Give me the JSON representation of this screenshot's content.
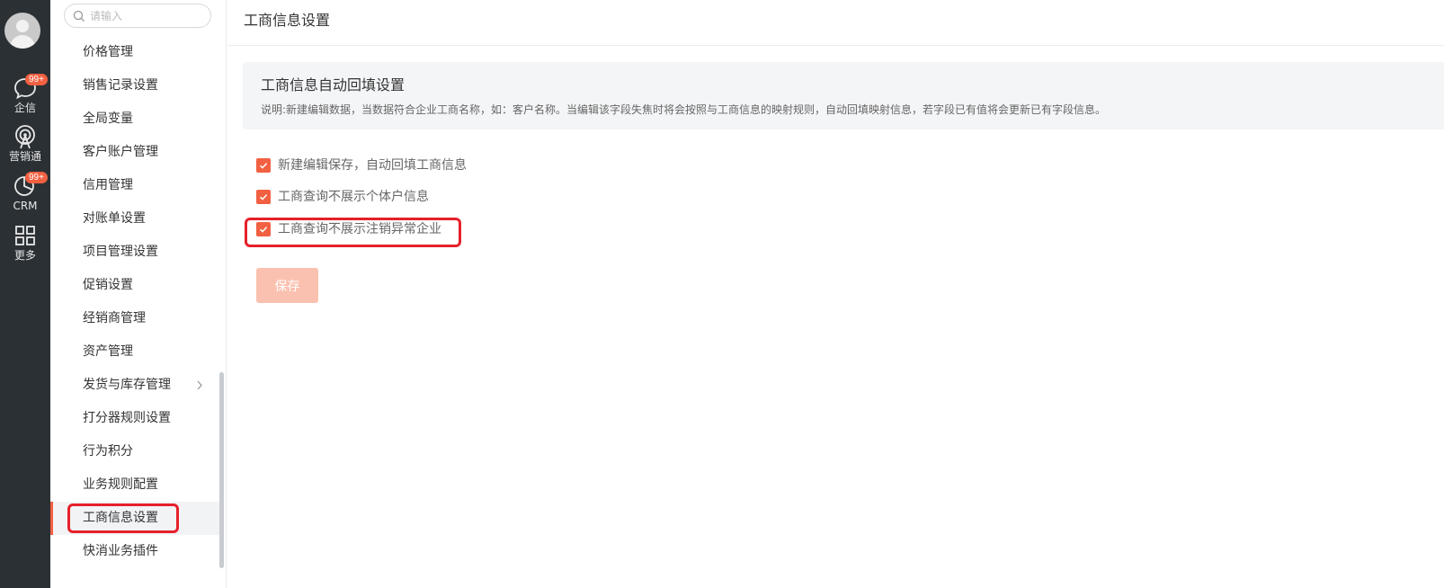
{
  "rail": {
    "items": [
      {
        "label": "企信",
        "icon": "chat-bubble-icon",
        "badge": "99+"
      },
      {
        "label": "营销通",
        "icon": "broadcast-icon",
        "badge": ""
      },
      {
        "label": "CRM",
        "icon": "pie-chart-icon",
        "badge": "99+"
      },
      {
        "label": "更多",
        "icon": "grid-icon",
        "badge": ""
      }
    ]
  },
  "sidebar": {
    "search_placeholder": "请输入",
    "items": [
      {
        "label": "价格管理"
      },
      {
        "label": "销售记录设置"
      },
      {
        "label": "全局变量"
      },
      {
        "label": "客户账户管理"
      },
      {
        "label": "信用管理"
      },
      {
        "label": "对账单设置"
      },
      {
        "label": "项目管理设置"
      },
      {
        "label": "促销设置"
      },
      {
        "label": "经销商管理"
      },
      {
        "label": "资产管理"
      },
      {
        "label": "发货与库存管理"
      },
      {
        "label": "打分器规则设置"
      },
      {
        "label": "行为积分"
      },
      {
        "label": "业务规则配置"
      },
      {
        "label": "工商信息设置"
      },
      {
        "label": "快消业务插件"
      }
    ],
    "active_item": "工商信息设置"
  },
  "main": {
    "page_title": "工商信息设置",
    "info": {
      "title": "工商信息自动回填设置",
      "description": "说明:新建编辑数据，当数据符合企业工商名称，如：客户名称。当编辑该字段失焦时将会按照与工商信息的映射规则，自动回填映射信息，若字段已有值将会更新已有字段信息。"
    },
    "options": [
      {
        "label": "新建编辑保存，自动回填工商信息",
        "checked": true
      },
      {
        "label": "工商查询不展示个体户信息",
        "checked": true
      },
      {
        "label": "工商查询不展示注销异常企业",
        "checked": true
      }
    ],
    "save_label": "保存"
  },
  "colors": {
    "accent": "#f26042",
    "rail_bg": "#2b3034",
    "highlight_border": "#e6202a",
    "save_disabled": "#fbc1b0"
  }
}
